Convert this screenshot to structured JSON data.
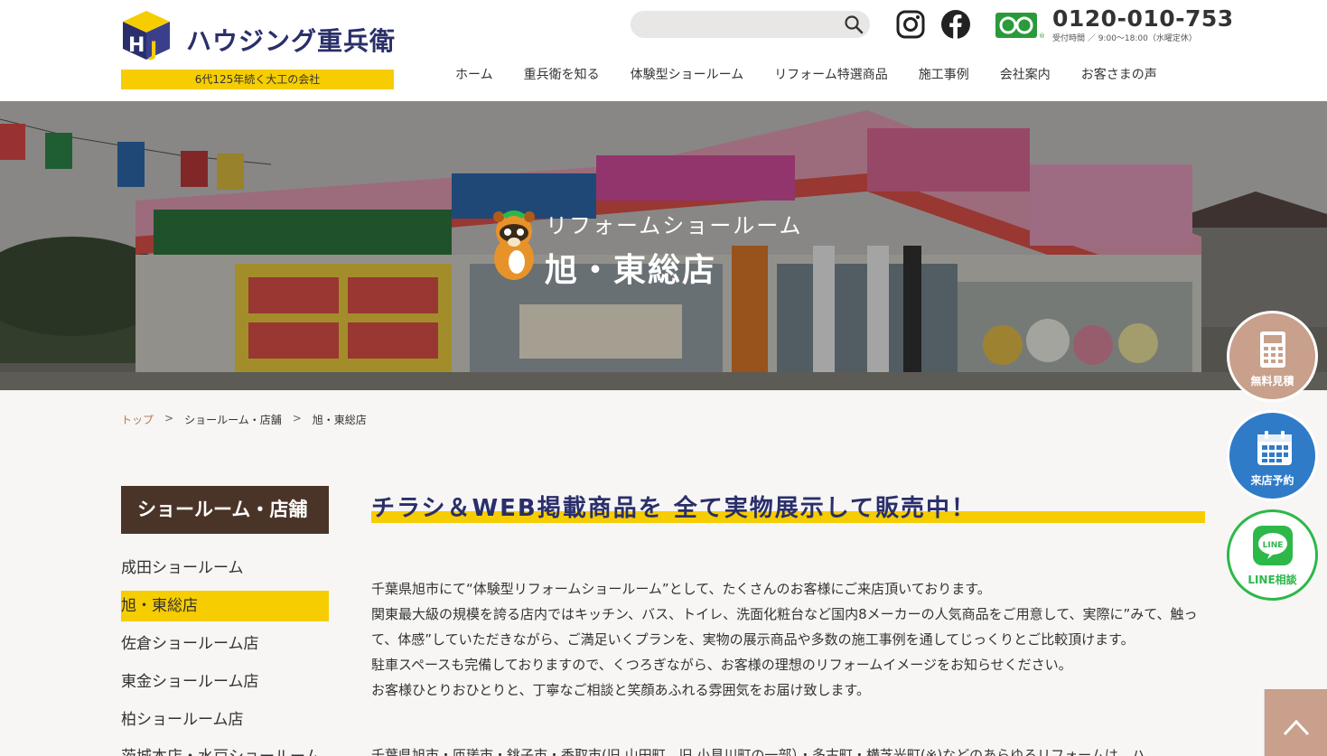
{
  "header": {
    "logo_text": "ハウジング重兵衛",
    "tagline": "6代125年続く大工の会社",
    "search_placeholder": "",
    "phone": "0120-010-753",
    "hours": "受付時間 ／ 9:00〜18:00（水曜定休）",
    "nav": [
      "ホーム",
      "重兵衛を知る",
      "体験型ショールーム",
      "リフォーム特選商品",
      "施工事例",
      "会社案内",
      "お客さまの声"
    ]
  },
  "hero": {
    "subtitle": "リフォームショールーム",
    "title": "旭・東総店"
  },
  "breadcrumb": {
    "items": [
      "トップ",
      "ショールーム・店舗",
      "旭・東総店"
    ],
    "separator": ">"
  },
  "sidebar": {
    "title": "ショールーム・店舗",
    "items": [
      {
        "label": "成田ショールーム",
        "active": false
      },
      {
        "label": "旭・東総店",
        "active": true
      },
      {
        "label": "佐倉ショールーム店",
        "active": false
      },
      {
        "label": "東金ショールーム店",
        "active": false
      },
      {
        "label": "柏ショールーム店",
        "active": false
      },
      {
        "label": "茨城本店・水戸ショールーム",
        "active": false
      }
    ]
  },
  "main": {
    "heading": "チラシ＆WEB掲載商品を 全て実物展示して販売中！",
    "paragraphs": [
      "千葉県旭市にて“体験型リフォームショールーム”として、たくさんのお客様にご来店頂いております。",
      "関東最大級の規模を誇る店内ではキッチン、バス、トイレ、洗面化粧台など国内8メーカーの人気商品をご用意して、実際に”みて、触って、体感”していただきながら、ご満足いくプランを、実物の展示商品や多数の施工事例を通してじっくりとご比較頂けます。",
      "駐車スペースも完備しておりますので、くつろぎながら、お客様の理想のリフォームイメージをお知らせください。",
      "お客様ひとりおひとりと、丁寧なご相談と笑顔あふれる雰囲気をお届け致します。"
    ],
    "cut_line": "千葉県旭市・匝瑳市・銚子市・香取市(旧 山田町、旧 小見川町の一部）・多古町・横芝光町(※)などのあらゆるリフォームは、ハ"
  },
  "floating": {
    "estimate": "無料見積",
    "reserve": "来店予約",
    "line": "LINE相談",
    "line_badge": "LINE"
  },
  "colors": {
    "accent_yellow": "#f6cd00",
    "navy": "#2a2f6b",
    "brown": "#4a3428",
    "estimate_bg": "#c8a08b",
    "reserve_bg": "#2f7bc8",
    "line_green": "#2db84a"
  }
}
